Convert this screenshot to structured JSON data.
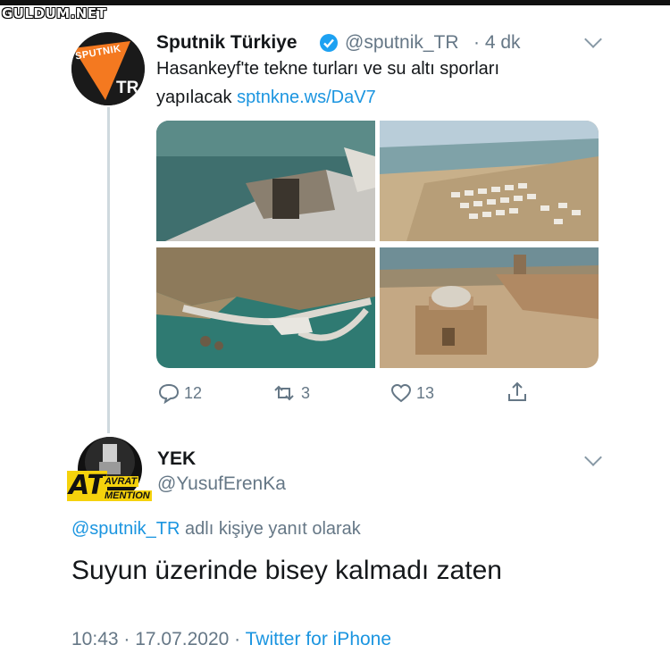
{
  "watermark": "GULDUM.NET",
  "tweet": {
    "author_name": "Sputnik Türkiye",
    "author_handle": "@sputnik_TR",
    "time": "· 4 dk",
    "avatar_text_top": "SPUTNIK",
    "avatar_text_bottom": "TR",
    "text_line1": "Hasankeyf'te tekne turları ve su altı sporları",
    "text_line2": "yapılacak",
    "link": "sptnkne.ws/DaV7",
    "actions": {
      "replies": "12",
      "retweets": "3",
      "likes": "13"
    }
  },
  "reply": {
    "author_name": "YEK",
    "author_handle": "@YusufErenKa",
    "avatar_text_big": "AT",
    "avatar_text_small1": "AVRAT",
    "avatar_text_small2": "MENTION",
    "reply_to_handle": "@sputnik_TR",
    "reply_to_suffix": "adlı kişiye yanıt olarak",
    "text": "Suyun üzerinde bisey kalmadı zaten",
    "timestamp": "10:43 · 17.07.2020 ·",
    "source": "Twitter for iPhone"
  },
  "colors": {
    "link": "#1b95e0",
    "muted": "#657786",
    "verified": "#1da1f2",
    "sputnik_orange": "#f47920"
  }
}
